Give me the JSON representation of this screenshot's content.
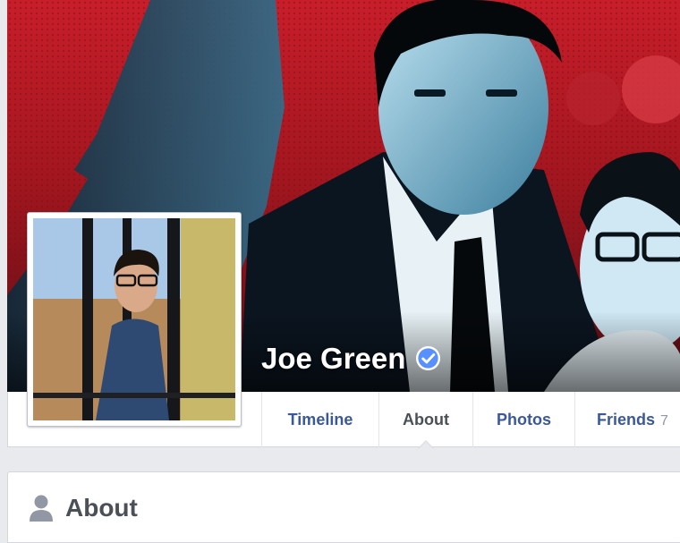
{
  "profile": {
    "name": "Joe Green",
    "verified": true,
    "accent_color": "#3b5998",
    "badge_color": "#5890ff"
  },
  "tabs": [
    {
      "label": "Timeline",
      "active": false
    },
    {
      "label": "About",
      "active": true
    },
    {
      "label": "Photos",
      "active": false
    },
    {
      "label": "Friends",
      "count": "7",
      "active": false
    }
  ],
  "about_section": {
    "title": "About",
    "icon": "person-icon"
  }
}
